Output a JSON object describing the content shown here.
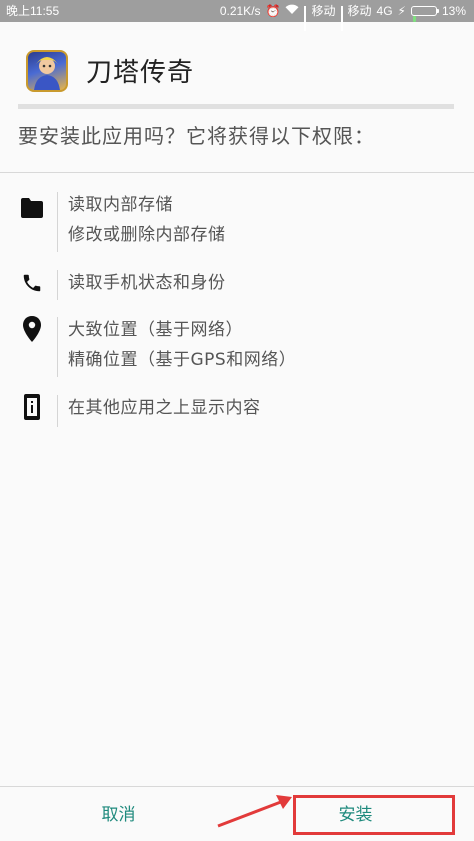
{
  "status_bar": {
    "time": "晚上11:55",
    "speed": "0.21K/s",
    "carrier1": "移动",
    "carrier2": "移动",
    "network": "4G",
    "battery": "13%",
    "battery_level": 0.13
  },
  "app": {
    "title": "刀塔传奇"
  },
  "prompt": "要安装此应用吗？它将获得以下权限：",
  "permissions": [
    {
      "icon": "folder-icon",
      "lines": [
        "读取内部存储",
        "修改或删除内部存储"
      ]
    },
    {
      "icon": "phone-icon",
      "lines": [
        "读取手机状态和身份"
      ]
    },
    {
      "icon": "location-pin-icon",
      "lines": [
        "大致位置（基于网络）",
        "精确位置（基于GPS和网络）"
      ]
    },
    {
      "icon": "info-device-icon",
      "lines": [
        "在其他应用之上显示内容"
      ]
    }
  ],
  "buttons": {
    "cancel": "取消",
    "install": "安装"
  },
  "colors": {
    "accent": "#1f8a7d",
    "annotation": "#e23a3a"
  }
}
